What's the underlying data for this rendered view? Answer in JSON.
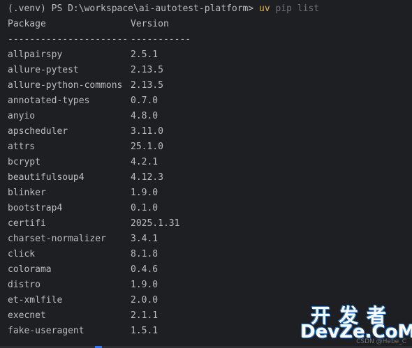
{
  "prompt": {
    "text": "(.venv) PS D:\\workspace\\ai-autotest-platform> ",
    "command": "uv",
    "args": " pip list"
  },
  "table": {
    "header_package": "Package",
    "header_version": "Version",
    "sep_package": "----------------------",
    "sep_version": "-----------",
    "rows": [
      {
        "package": "allpairspy",
        "version": "2.5.1"
      },
      {
        "package": "allure-pytest",
        "version": "2.13.5"
      },
      {
        "package": "allure-python-commons",
        "version": "2.13.5"
      },
      {
        "package": "annotated-types",
        "version": "0.7.0"
      },
      {
        "package": "anyio",
        "version": "4.8.0"
      },
      {
        "package": "apscheduler",
        "version": "3.11.0"
      },
      {
        "package": "attrs",
        "version": "25.1.0"
      },
      {
        "package": "bcrypt",
        "version": "4.2.1"
      },
      {
        "package": "beautifulsoup4",
        "version": "4.12.3"
      },
      {
        "package": "blinker",
        "version": "1.9.0"
      },
      {
        "package": "bootstrap4",
        "version": "0.1.0"
      },
      {
        "package": "certifi",
        "version": "2025.1.31"
      },
      {
        "package": "charset-normalizer",
        "version": "3.4.1"
      },
      {
        "package": "click",
        "version": "8.1.8"
      },
      {
        "package": "colorama",
        "version": "0.4.6"
      },
      {
        "package": "distro",
        "version": "1.9.0"
      },
      {
        "package": "et-xmlfile",
        "version": "2.0.0"
      },
      {
        "package": "execnet",
        "version": "2.1.1"
      },
      {
        "package": "fake-useragent",
        "version": "1.5.1"
      }
    ]
  },
  "watermark": {
    "cn": "开发者",
    "en": "DevZe.CoM",
    "credit": "CSDN @Hebe_C"
  },
  "colors": {
    "background": "#1e1f22",
    "text": "#bcbec4",
    "command": "#e0b64b",
    "args": "#6f737a"
  }
}
